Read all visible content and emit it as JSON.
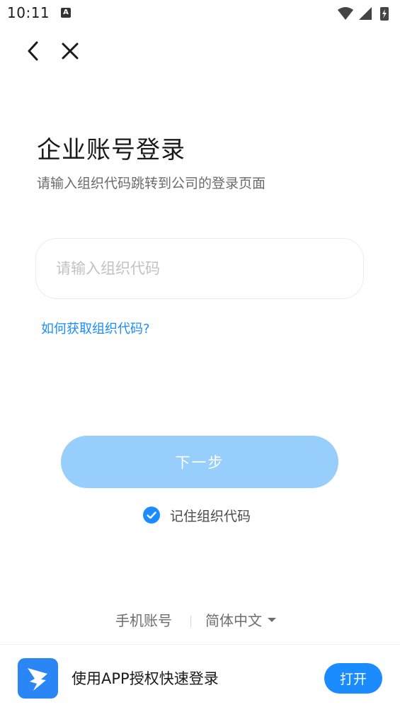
{
  "status_bar": {
    "time": "10:11",
    "notification_letter": "A"
  },
  "nav": {
    "back_icon": "chevron-left-icon",
    "close_icon": "close-icon"
  },
  "page": {
    "title": "企业账号登录",
    "subtitle": "请输入组织代码跳转到公司的登录页面"
  },
  "form": {
    "org_code_value": "",
    "org_code_placeholder": "请输入组织代码",
    "help_link": "如何获取组织代码?",
    "next_button": "下一步",
    "remember_label": "记住组织代码",
    "remember_checked": true
  },
  "footer": {
    "phone_account": "手机账号",
    "language": "简体中文"
  },
  "app_banner": {
    "text": "使用APP授权快速登录",
    "open_button": "打开"
  },
  "colors": {
    "accent": "#1a8cff",
    "button_disabled": "#85c6fb",
    "logo_bg": "#2b86f5"
  }
}
